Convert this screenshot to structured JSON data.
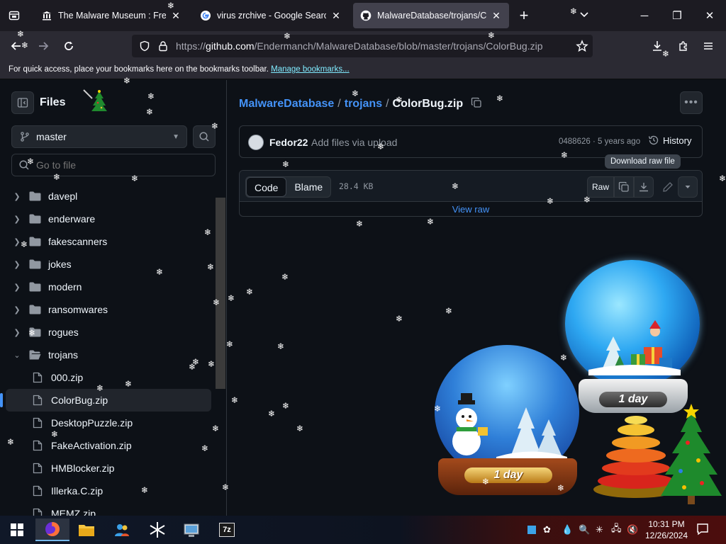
{
  "browser": {
    "tabs": [
      {
        "title": "The Malware Museum : Free Sc",
        "favicon": "museum-icon",
        "active": false
      },
      {
        "title": "virus zrchive - Google Search",
        "favicon": "google-icon",
        "active": false
      },
      {
        "title": "MalwareDatabase/trojans/Colo",
        "favicon": "github-icon",
        "active": true
      }
    ],
    "new_tab": "+",
    "window_controls": {
      "minimize": "─",
      "maximize": "❐",
      "close": "✕"
    },
    "url": {
      "prefix": "https://",
      "host": "github.com",
      "path": "/Endermanch/MalwareDatabase/blob/master/trojans/ColorBug.zip"
    },
    "bookmarks_bar": {
      "text": "For quick access, place your bookmarks here on the bookmarks toolbar.",
      "link": "Manage bookmarks..."
    }
  },
  "sidebar": {
    "title": "Files",
    "branch": "master",
    "goto_placeholder": "Go to file",
    "items": [
      {
        "name": "davepl",
        "type": "dir",
        "expanded": false
      },
      {
        "name": "enderware",
        "type": "dir",
        "expanded": false
      },
      {
        "name": "fakescanners",
        "type": "dir",
        "expanded": false
      },
      {
        "name": "jokes",
        "type": "dir",
        "expanded": false
      },
      {
        "name": "modern",
        "type": "dir",
        "expanded": false
      },
      {
        "name": "ransomwares",
        "type": "dir",
        "expanded": false
      },
      {
        "name": "rogues",
        "type": "dir",
        "expanded": false
      },
      {
        "name": "trojans",
        "type": "dir",
        "expanded": true
      },
      {
        "name": "000.zip",
        "type": "file"
      },
      {
        "name": "ColorBug.zip",
        "type": "file",
        "selected": true
      },
      {
        "name": "DesktopPuzzle.zip",
        "type": "file"
      },
      {
        "name": "FakeActivation.zip",
        "type": "file"
      },
      {
        "name": "HMBlocker.zip",
        "type": "file"
      },
      {
        "name": "Illerka.C.zip",
        "type": "file"
      },
      {
        "name": "MEMZ.zip",
        "type": "file"
      }
    ]
  },
  "main": {
    "breadcrumb": {
      "repo": "MalwareDatabase",
      "folder": "trojans",
      "file": "ColorBug.zip",
      "separator": "/"
    },
    "commit": {
      "author": "Fedor22",
      "message": "Add files via upload",
      "sha_age": "0488626 · 5 years ago",
      "history_label": "History"
    },
    "tooltip": "Download raw file",
    "file": {
      "tab_code": "Code",
      "tab_blame": "Blame",
      "size": "28.4 KB",
      "raw_label": "Raw",
      "view_raw": "View raw"
    }
  },
  "overlay": {
    "globe_label": "1 day",
    "globe_label_small": "1 day"
  },
  "taskbar": {
    "clock_time": "10:31 PM",
    "clock_date": "12/26/2024",
    "apps": [
      "windows-start-icon",
      "firefox-icon",
      "file-explorer-icon",
      "people-icon",
      "snowflake-app-icon",
      "control-panel-icon",
      "7zip-icon"
    ],
    "seven_zip_label": "7z"
  },
  "colors": {
    "accent": "#4493f8",
    "bg": "#0d1117",
    "border": "#30363d",
    "text": "#f0f6fc",
    "muted": "#9198a1"
  }
}
